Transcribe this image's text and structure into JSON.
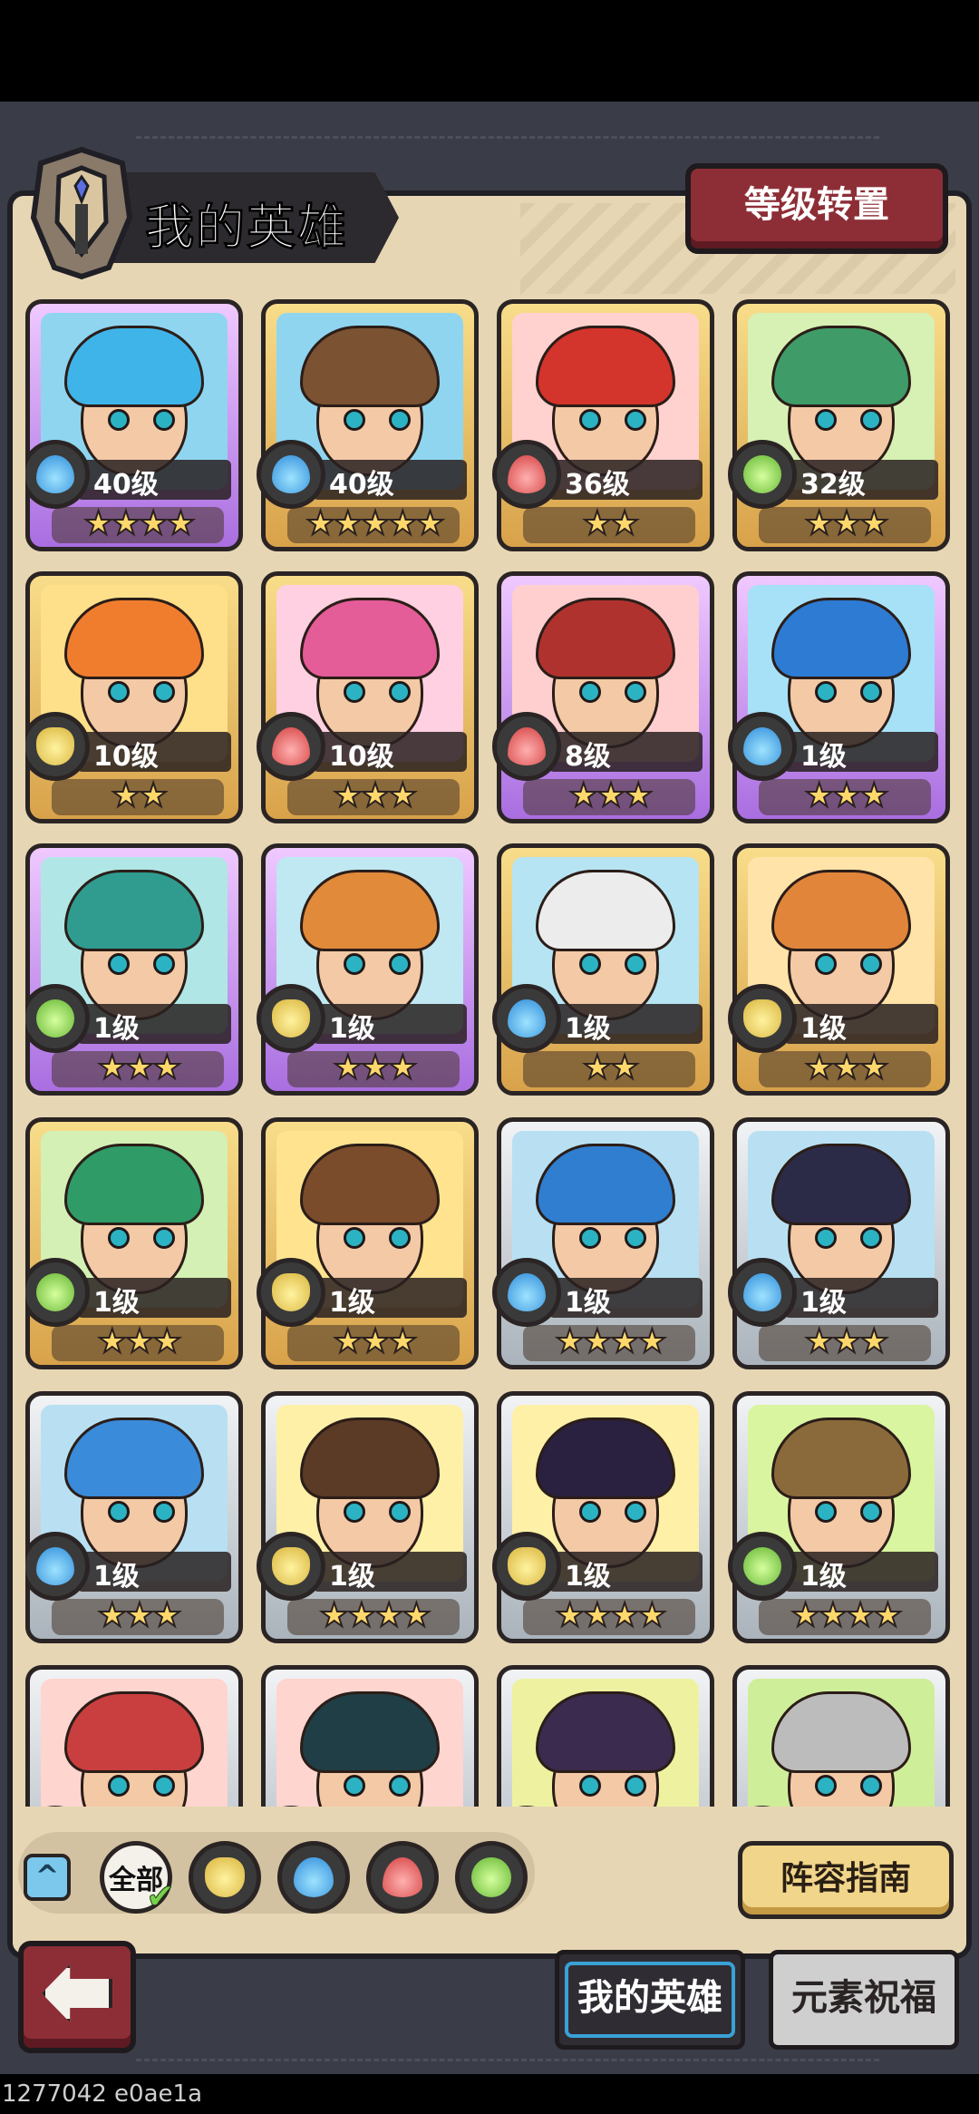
{
  "header": {
    "title": "我的英雄",
    "level_transfer_button": "等级转置"
  },
  "colors": {
    "panel_bg": "#e7d6b4",
    "accent_red": "#8d2e36",
    "gold_card": "#f1c46a",
    "purple_card": "#c18bf2",
    "silver_card": "#d7dde2"
  },
  "heroes": [
    {
      "level": "40级",
      "stars": "★★★★",
      "element": "water",
      "frame": "purple",
      "hair": "#3fb4e8",
      "bg": "#8fd5f0"
    },
    {
      "level": "40级",
      "stars": "★★★★★",
      "element": "water",
      "frame": "gold",
      "hair": "#7b5232",
      "bg": "#8fd5f0"
    },
    {
      "level": "36级",
      "stars": "★★",
      "element": "fire",
      "frame": "gold",
      "hair": "#d3342b",
      "bg": "#ffd2cf"
    },
    {
      "level": "32级",
      "stars": "★★★",
      "element": "wind",
      "frame": "gold",
      "hair": "#3f9b68",
      "bg": "#d7f0b3"
    },
    {
      "level": "10级",
      "stars": "★★",
      "element": "earth",
      "frame": "gold",
      "hair": "#f07d2e",
      "bg": "#ffe08a"
    },
    {
      "level": "10级",
      "stars": "★★★",
      "element": "fire",
      "frame": "gold",
      "hair": "#e45c98",
      "bg": "#ffd0e1"
    },
    {
      "level": "8级",
      "stars": "★★★",
      "element": "fire",
      "frame": "purple",
      "hair": "#b0322f",
      "bg": "#ffcfcf"
    },
    {
      "level": "1级",
      "stars": "★★★",
      "element": "water",
      "frame": "purple",
      "hair": "#2d7bd3",
      "bg": "#a7e1f7"
    },
    {
      "level": "1级",
      "stars": "★★★",
      "element": "wind",
      "frame": "purple",
      "hair": "#2f9c8f",
      "bg": "#b0e7e6"
    },
    {
      "level": "1级",
      "stars": "★★★",
      "element": "earth",
      "frame": "purple",
      "hair": "#e08a3a",
      "bg": "#bfe8f2"
    },
    {
      "level": "1级",
      "stars": "★★",
      "element": "water",
      "frame": "gold",
      "hair": "#ececec",
      "bg": "#b7e4f2"
    },
    {
      "level": "1级",
      "stars": "★★★",
      "element": "earth",
      "frame": "gold",
      "hair": "#e1853b",
      "bg": "#ffe3a8"
    },
    {
      "level": "1级",
      "stars": "★★★",
      "element": "wind",
      "frame": "gold",
      "hair": "#2f9b67",
      "bg": "#d4f0b5"
    },
    {
      "level": "1级",
      "stars": "★★★",
      "element": "earth",
      "frame": "gold",
      "hair": "#7b4c2b",
      "bg": "#ffe38f"
    },
    {
      "level": "1级",
      "stars": "★★★★",
      "element": "water",
      "frame": "silver",
      "hair": "#2f7ed0",
      "bg": "#b8e0f2"
    },
    {
      "level": "1级",
      "stars": "★★★",
      "element": "water",
      "frame": "silver",
      "hair": "#2b2b48",
      "bg": "#b8e0f2"
    },
    {
      "level": "1级",
      "stars": "★★★",
      "element": "water",
      "frame": "silver",
      "hair": "#3a8bd9",
      "bg": "#b8e0f2"
    },
    {
      "level": "1级",
      "stars": "★★★★",
      "element": "earth",
      "frame": "silver",
      "hair": "#5b3a26",
      "bg": "#fff0a8"
    },
    {
      "level": "1级",
      "stars": "★★★★",
      "element": "earth",
      "frame": "silver",
      "hair": "#2a2040",
      "bg": "#fff0a8"
    },
    {
      "level": "1级",
      "stars": "★★★★",
      "element": "wind",
      "frame": "silver",
      "hair": "#8a6a3b",
      "bg": "#d9f5a0"
    },
    {
      "level": "",
      "stars": "",
      "element": "fire",
      "frame": "silver",
      "hair": "#c93e3e",
      "bg": "#ffd5cf"
    },
    {
      "level": "",
      "stars": "",
      "element": "fire",
      "frame": "silver",
      "hair": "#1f3e46",
      "bg": "#ffd5cf"
    },
    {
      "level": "",
      "stars": "",
      "element": "earth",
      "frame": "silver",
      "hair": "#3b2b4e",
      "bg": "#eef2a0"
    },
    {
      "level": "",
      "stars": "",
      "element": "wind",
      "frame": "silver",
      "hair": "#bcbcbc",
      "bg": "#cfee9a"
    }
  ],
  "filter": {
    "all_label": "全部",
    "elements": [
      "earth",
      "water",
      "fire",
      "wind"
    ]
  },
  "lineup_guide_button": "阵容指南",
  "tabs": {
    "my_heroes": "我的英雄",
    "element_blessing": "元素祝福"
  },
  "icons": {
    "back": "back-arrow-icon",
    "collapse": "chevron-up-icon",
    "helmet": "helmet-emblem-icon"
  },
  "build_id": "1277042 e0ae1a"
}
